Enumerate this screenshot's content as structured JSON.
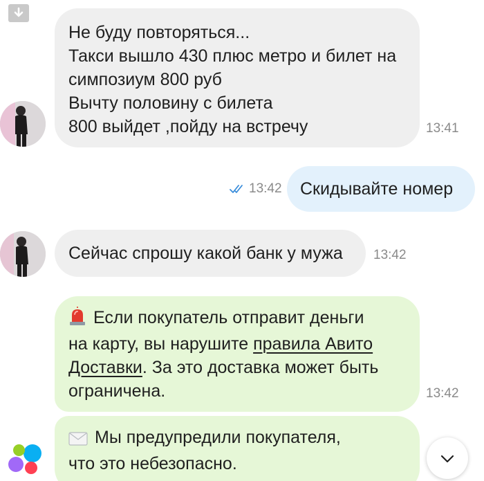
{
  "messages": {
    "m1": {
      "lines": [
        "Не буду повторяться...",
        "Такси вышло 430 плюс метро и билет на",
        "симпозиум 800 руб",
        "Вычту половину с билета",
        "800 выйдет ,пойду на встречу"
      ],
      "time": "13:41"
    },
    "m2": {
      "text": "Скидывайте номер",
      "time": "13:42"
    },
    "m3": {
      "text": "Сейчас спрошу какой банк у мужа",
      "time": "13:42"
    },
    "m4": {
      "line1": "Если покупатель отправит деньги",
      "line2_pre": "на карту, вы нарушите ",
      "link_part1": "правила Авито",
      "link_part2": "Доставки",
      "line3_post": ". За это доставка может быть",
      "line4": "ограничена.",
      "time": "13:42",
      "icon": "siren-icon"
    },
    "m5": {
      "line1": "Мы предупредили покупателя,",
      "line2": "что это небезопасно.",
      "icon": "envelope-icon"
    }
  },
  "colors": {
    "incoming": "#efefef",
    "outgoing": "#e3f1fc",
    "system": "#e6f7d7",
    "read_check": "#3a8ddb",
    "time": "#8a8a8a"
  },
  "icons": {
    "top_left": "download-icon",
    "read_status": "double-check-icon",
    "scroll": "chevron-down-icon",
    "logo": "avito-logo"
  }
}
